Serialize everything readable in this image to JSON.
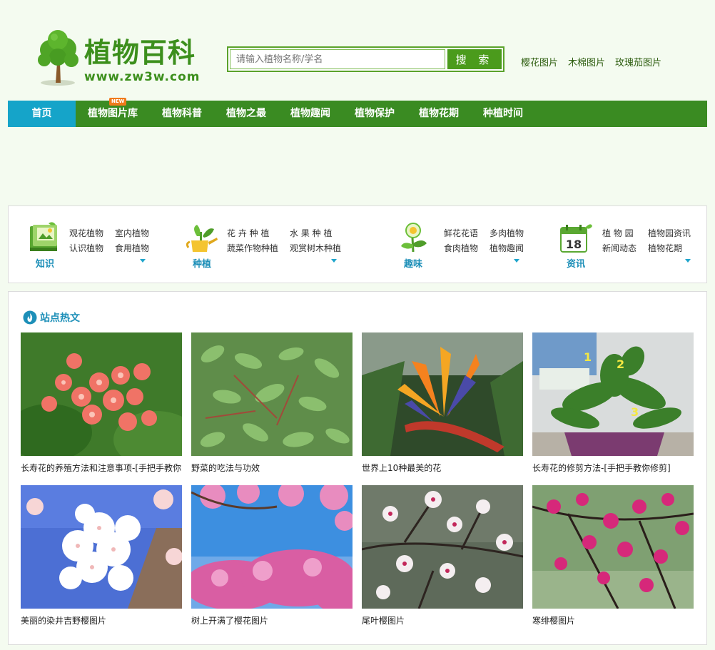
{
  "header": {
    "logo_title": "植物百科",
    "logo_url": "www.zw3w.com",
    "search_placeholder": "请输入植物名称/学名",
    "search_button": "搜 索",
    "hot_links": [
      "樱花图片",
      "木棉图片",
      "玫瑰茄图片"
    ]
  },
  "nav": {
    "items": [
      {
        "label": "首页",
        "active": true
      },
      {
        "label": "植物图片库",
        "badge": "NEW"
      },
      {
        "label": "植物科普"
      },
      {
        "label": "植物之最"
      },
      {
        "label": "植物趣闻"
      },
      {
        "label": "植物保护"
      },
      {
        "label": "植物花期"
      },
      {
        "label": "种植时间"
      }
    ]
  },
  "categories": [
    {
      "label": "知识",
      "icon": "book-icon",
      "links": [
        "观花植物",
        "室内植物",
        "认识植物",
        "食用植物"
      ]
    },
    {
      "label": "种植",
      "icon": "watering-can-icon",
      "links": [
        "花 卉 种 植",
        "水 果 种 植",
        "蔬菜作物种植",
        "观赏树木种植"
      ]
    },
    {
      "label": "趣味",
      "icon": "flower-icon",
      "links": [
        "鲜花花语",
        "多肉植物",
        "食肉植物",
        "植物趣闻"
      ]
    },
    {
      "label": "资讯",
      "icon": "calendar-icon",
      "calendar_day": "18",
      "links": [
        "植 物 园",
        "植物园资讯",
        "新闻动态",
        "植物花期"
      ]
    }
  ],
  "hot": {
    "title": "站点热文",
    "articles": [
      {
        "caption": "长寿花的养殖方法和注意事项-[手把手教你"
      },
      {
        "caption": "野菜的吃法与功效"
      },
      {
        "caption": "世界上10种最美的花"
      },
      {
        "caption": "长寿花的修剪方法-[手把手教你修剪]",
        "photo_labels": [
          "1",
          "2",
          "3"
        ]
      },
      {
        "caption": "美丽的染井吉野樱图片"
      },
      {
        "caption": "树上开满了樱花图片"
      },
      {
        "caption": "尾叶樱图片"
      },
      {
        "caption": "寒绯樱图片"
      }
    ]
  },
  "colors": {
    "brand_green": "#3a8b22",
    "nav_active": "#15a4c9",
    "accent_blue": "#1d8fb8"
  }
}
